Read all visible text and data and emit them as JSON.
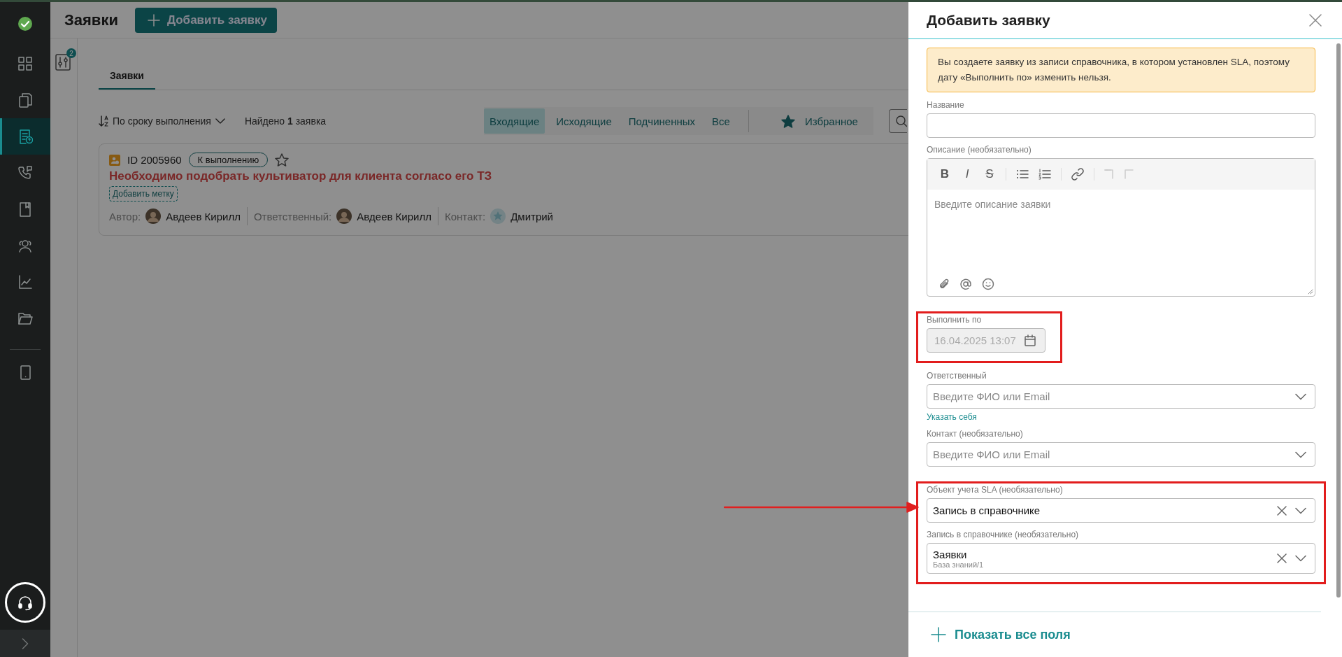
{
  "sidebar": {
    "items": [
      {
        "selected": false
      },
      {
        "selected": false
      },
      {
        "selected": true
      },
      {
        "selected": false
      },
      {
        "selected": false
      },
      {
        "selected": false
      },
      {
        "selected": false
      },
      {
        "selected": false
      }
    ],
    "extra_items": [
      {
        "selected": false
      }
    ]
  },
  "header": {
    "title": "Заявки",
    "add_button": "Добавить заявку"
  },
  "filter_badge": "2",
  "tabs": [
    {
      "label": "Заявки",
      "selected": true
    }
  ],
  "toolbar": {
    "sort": "По сроку выполнения",
    "found": "Найдено **1** заявка",
    "filters": [
      {
        "label": "Входящие",
        "selected": true
      },
      {
        "label": "Исходящие",
        "selected": false
      },
      {
        "label": "Подчиненных",
        "selected": false
      },
      {
        "label": "Все",
        "selected": false
      }
    ],
    "favorites": {
      "label": "Избранное",
      "selected": false
    }
  },
  "cards": [
    {
      "id": "ID 2005960",
      "status": "К выполнению",
      "starred": false,
      "title": "Необходимо подобрать культиватор для клиента согласо его ТЗ",
      "tag_button": "Добавить метку",
      "meta": [
        {
          "kind": "person",
          "label": "Автор:",
          "name": "Авдеев Кирилл"
        },
        {
          "kind": "person",
          "label": "Ответственный:",
          "name": "Авдеев Кирилл"
        },
        {
          "kind": "contact",
          "label": "Контакт:",
          "name": "Дмитрий"
        }
      ]
    }
  ],
  "panel": {
    "title": "Добавить заявку",
    "alert": "Вы создаете заявку из записи справочника, в котором установлен SLA, поэтому дату «Выполнить по» изменить нельзя.",
    "field_groups": [
      {
        "highlighted": false,
        "fields": [
          {
            "kind": "text",
            "label": "Название"
          },
          {
            "kind": "editor",
            "label": "Описание (необязательно)",
            "placeholder": "Введите описание заявки",
            "format_buttons": [
              "B",
              "I",
              "S"
            ]
          }
        ]
      },
      {
        "highlighted": true,
        "fields": [
          {
            "kind": "date",
            "label": "Выполнить по",
            "value": "16.04.2025 13:07",
            "disabled": true
          }
        ]
      },
      {
        "highlighted": false,
        "fields": [
          {
            "kind": "select",
            "label": "Ответственный",
            "placeholder": "Введите ФИО или Email",
            "link": "Указать себя"
          },
          {
            "kind": "select",
            "label": "Контакт (необязательно)",
            "placeholder": "Введите ФИО или Email"
          }
        ]
      },
      {
        "highlighted": true,
        "fields": [
          {
            "kind": "select",
            "label": "Объект учета SLA (необязательно)",
            "value": "Запись в справочнике",
            "clearable": true
          },
          {
            "kind": "select",
            "label": "Запись в справочнике (необязательно)",
            "value": "Заявки",
            "subtitle": "База знаний/1",
            "clearable": true
          }
        ]
      }
    ],
    "show_all": "Показать все поля"
  }
}
